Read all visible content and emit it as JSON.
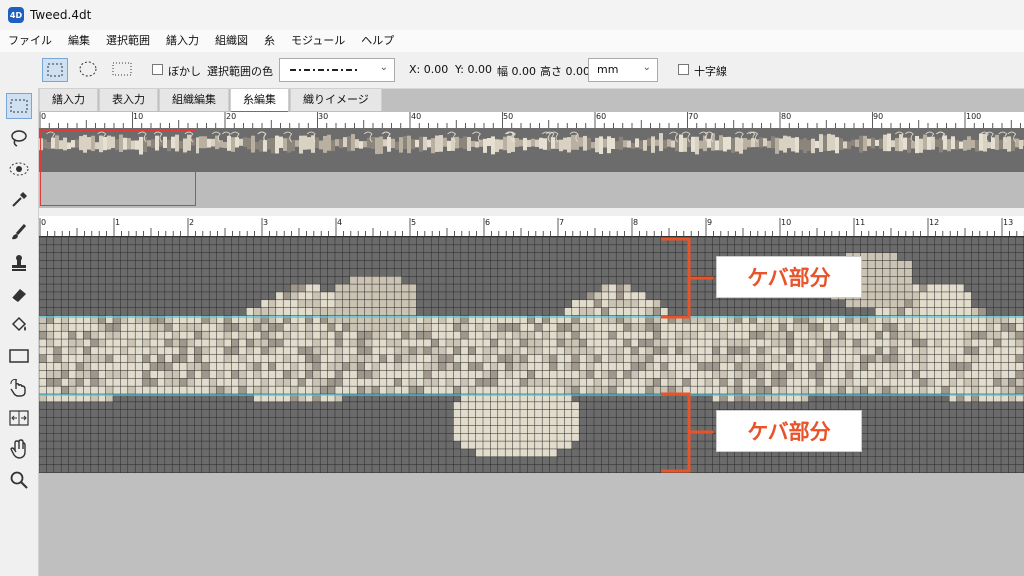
{
  "window": {
    "title": "Tweed.4dt",
    "app_icon": "4D"
  },
  "menubar": [
    "ファイル",
    "編集",
    "選択範囲",
    "繕入力",
    "組織図",
    "糸",
    "モジュール",
    "ヘルプ"
  ],
  "toolbar": {
    "selection_tools": [
      "rect-select-icon",
      "ellipse-select-icon",
      "dotted-rect-select-icon"
    ],
    "blur_label": "ぼかし",
    "selection_color_label": "選択範囲の色",
    "x_label": "X: 0.00",
    "y_label": "Y: 0.00",
    "width_label": "幅 0.00",
    "height_label": "高さ 0.00",
    "unit": "mm",
    "crosshair_label": "十字線"
  },
  "tools": [
    "rect-select-icon",
    "lasso-icon",
    "eye-select-icon",
    "eyedropper-icon",
    "brush-icon",
    "stamp-icon",
    "eraser-icon",
    "fill-bucket-icon",
    "rectangle-icon",
    "pointer-hand-icon",
    "move-icon",
    "hand-icon",
    "zoom-icon"
  ],
  "tabs": [
    {
      "label": "繕入力",
      "active": false
    },
    {
      "label": "表入力",
      "active": false
    },
    {
      "label": "組織編集",
      "active": false
    },
    {
      "label": "糸編集",
      "active": true
    },
    {
      "label": "織りイメージ",
      "active": false
    }
  ],
  "overview_ruler": [
    "0",
    "10",
    "20",
    "30",
    "40",
    "50",
    "60",
    "70",
    "80",
    "90",
    "100"
  ],
  "detail_ruler": [
    "0",
    "1",
    "2",
    "3",
    "4",
    "5",
    "6",
    "7",
    "8",
    "9",
    "10",
    "11",
    "12",
    "13"
  ],
  "annotations": [
    {
      "label": "ケバ部分"
    },
    {
      "label": "ケバ部分"
    }
  ],
  "colors": {
    "grid_dark": "#6b6b6b",
    "grid_light": "#e2dccd",
    "grid_mid": "#9f978c",
    "grid_tan": "#cbc3b3",
    "guide_line": "#4cc7e0",
    "annotation_red": "#e8532a"
  }
}
